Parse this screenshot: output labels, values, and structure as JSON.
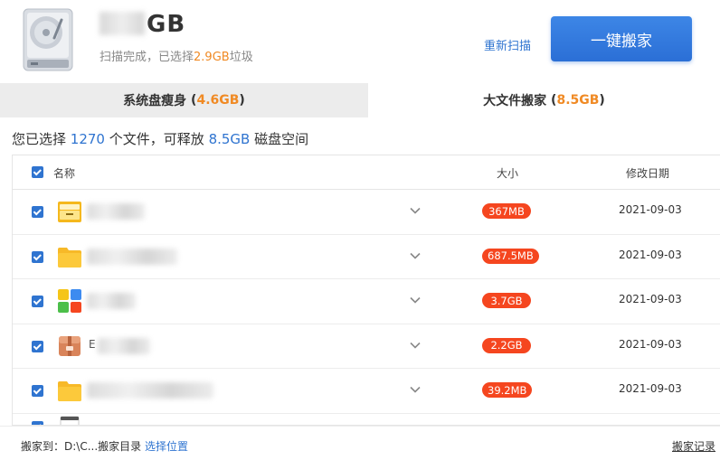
{
  "header": {
    "title_suffix": "GB",
    "subtitle_prefix": "扫描完成，已选择",
    "subtitle_size": "2.9GB",
    "subtitle_suffix": "垃圾",
    "rescan_label": "重新扫描",
    "primary_action_label": "一键搬家"
  },
  "tabs": [
    {
      "label": "系统盘瘦身",
      "size": "4.6GB"
    },
    {
      "label": "大文件搬家",
      "size": "8.5GB"
    }
  ],
  "summary": {
    "prefix": "您已选择",
    "file_count": "1270",
    "mid": "个文件，可释放",
    "size": "8.5GB",
    "suffix": "磁盘空间"
  },
  "table": {
    "columns": {
      "name": "名称",
      "size": "大小",
      "date": "修改日期"
    },
    "rows": [
      {
        "icon": "archive-folder-icon",
        "size": "367MB",
        "date": "2021-09-03"
      },
      {
        "icon": "folder-icon",
        "size": "687.5MB",
        "date": "2021-09-03"
      },
      {
        "icon": "app-icon",
        "size": "3.7GB",
        "date": "2021-09-03"
      },
      {
        "icon": "package-icon",
        "name_start": "E",
        "size": "2.2GB",
        "date": "2021-09-03"
      },
      {
        "icon": "folder-icon",
        "size": "39.2MB",
        "date": "2021-09-03"
      }
    ]
  },
  "footer": {
    "destination_label": "搬家到：",
    "destination_path": "D:\\C...搬家目录",
    "choose_location_label": "选择位置",
    "history_label": "搬家记录"
  },
  "colors": {
    "accent": "#2f74d0",
    "highlight": "#f08a24",
    "badge": "#f5461f",
    "tab_inactive_bg": "#ececec"
  }
}
